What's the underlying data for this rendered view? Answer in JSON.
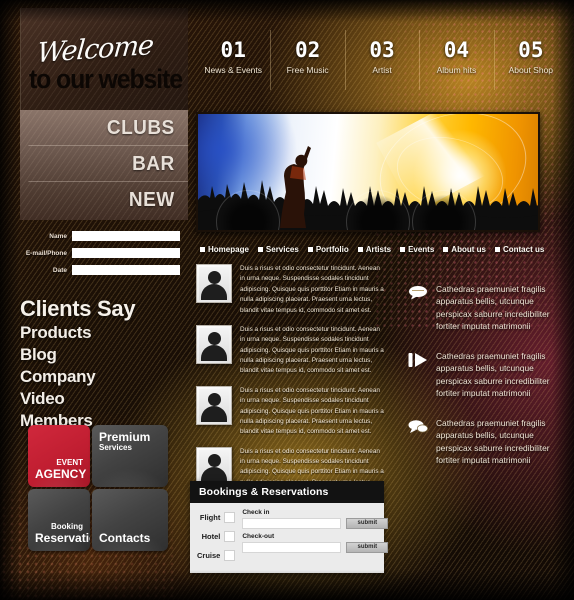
{
  "header": {
    "welcome_script": "Welcome",
    "welcome_bold": "to our website",
    "nav": [
      {
        "num": "01",
        "label": "News & Events"
      },
      {
        "num": "02",
        "label": "Free Music"
      },
      {
        "num": "03",
        "label": "Artist"
      },
      {
        "num": "04",
        "label": "Album hits"
      },
      {
        "num": "05",
        "label": "About Shop"
      }
    ]
  },
  "sidebar": {
    "top_links": [
      "CLUBS",
      "BAR",
      "NEW"
    ],
    "form": {
      "fields": [
        {
          "label": "Name",
          "value": "",
          "placeholder": ""
        },
        {
          "label": "E-mail/Phone",
          "value": "",
          "placeholder": ""
        },
        {
          "label": "Date",
          "value": "",
          "placeholder": ""
        }
      ]
    },
    "clients_title": "Clients Say",
    "client_links": [
      "Products",
      "Blog",
      "Company",
      "Video",
      "Members"
    ]
  },
  "tiles": [
    {
      "small": "EVENT",
      "big": "AGENCY",
      "color": "#c41f31",
      "align": "right",
      "position": "bottom"
    },
    {
      "small": "Services",
      "big": "Premium",
      "color": "#3d3d3d",
      "align": "left",
      "position": "top"
    },
    {
      "small": "Booking",
      "big": "Reservations",
      "color": "#3d3d3d",
      "align": "right",
      "position": "bottom"
    },
    {
      "small": "",
      "big": "Contacts",
      "color": "#3d3d3d",
      "align": "left",
      "position": "bottom"
    }
  ],
  "breadcrumb": [
    "Homepage",
    "Services",
    "Portfolio",
    "Artists",
    "Events",
    "About us",
    "Contact us"
  ],
  "testimonials": [
    {
      "text": "Duis a risus et odio consectetur tincidunt. Aenean in urna neque. Suspendisse sodales tincidunt adipiscing. Quisque quis porttitor Etiam in mauris a nulla adipiscing placerat. Praesent urna lectus, blandit vitae tempus id, commodo sit amet est."
    },
    {
      "text": "Duis a risus et odio consectetur tincidunt. Aenean in urna neque. Suspendisse sodales tincidunt adipiscing. Quisque quis porttitor Etiam in mauris a nulla adipiscing placerat. Praesent urna lectus, blandit vitae tempus id, commodo sit amet est."
    },
    {
      "text": "Duis a risus et odio consectetur tincidunt. Aenean in urna neque. Suspendisse sodales tincidunt adipiscing. Quisque quis porttitor Etiam in mauris a nulla adipiscing placerat. Praesent urna lectus, blandit vitae tempus id, commodo sit amet est."
    },
    {
      "text": "Duis a risus et odio consectetur tincidunt. Aenean in urna neque. Suspendisse sodales tincidunt adipiscing. Quisque quis porttitor Etiam in mauris a nulla adipiscing placerat. Praesent urna lectus, blandit vitae tempus id, commodo sit amet est."
    }
  ],
  "right_column": [
    {
      "icon": "speech-bubble-icon",
      "text": "Cathedras praemuniet fragilis apparatus bellis, utcunque perspicax saburre incredibiliter fortiter imputat matrimonii"
    },
    {
      "icon": "play-icon",
      "text": "Cathedras praemuniet fragilis apparatus bellis, utcunque perspicax saburre incredibiliter fortiter imputat matrimonii"
    },
    {
      "icon": "speech-bubbles-icon",
      "text": "Cathedras praemuniet fragilis apparatus bellis, utcunque perspicax saburre incredibiliter fortiter imputat matrimonii"
    }
  ],
  "bookings": {
    "title": "Bookings & Reservations",
    "options": [
      "Flight",
      "Hotel",
      "Cruise"
    ],
    "checkin_label": "Check in",
    "checkin_value": "",
    "checkout_label": "Check-out",
    "checkout_value": "",
    "submit_label": "submit"
  },
  "colors": {
    "accent_red": "#c41f31",
    "tile_grey": "#3d3d3d",
    "bookings_header": "#121212",
    "bookings_body": "#ebebeb"
  }
}
